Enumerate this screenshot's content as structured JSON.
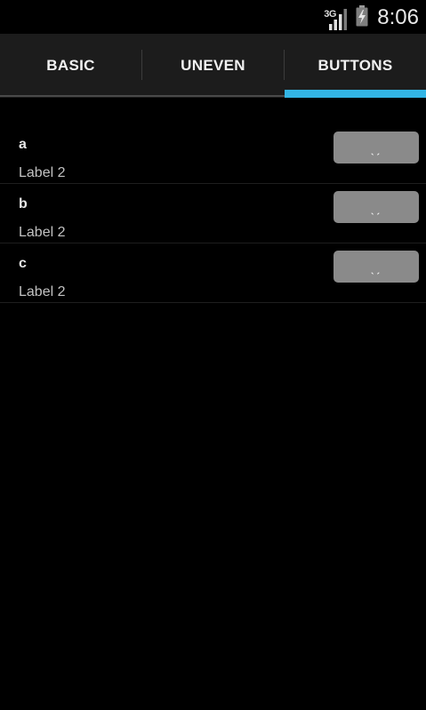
{
  "statusbar": {
    "network": "3G",
    "time": "8:06"
  },
  "tabs": [
    {
      "label": "BASIC",
      "selected": false
    },
    {
      "label": "UNEVEN",
      "selected": false
    },
    {
      "label": "BUTTONS",
      "selected": true
    }
  ],
  "colors": {
    "accent": "#33b5e5",
    "button_bg": "#8a8a8a",
    "tabbar_bg": "#1c1c1c",
    "background": "#000000"
  },
  "rows": [
    {
      "title": "a",
      "subtitle": "Label 2",
      "button_text": "ˎˏ"
    },
    {
      "title": "b",
      "subtitle": "Label 2",
      "button_text": "ˎˏ"
    },
    {
      "title": "c",
      "subtitle": "Label 2",
      "button_text": "ˎˏ"
    }
  ]
}
